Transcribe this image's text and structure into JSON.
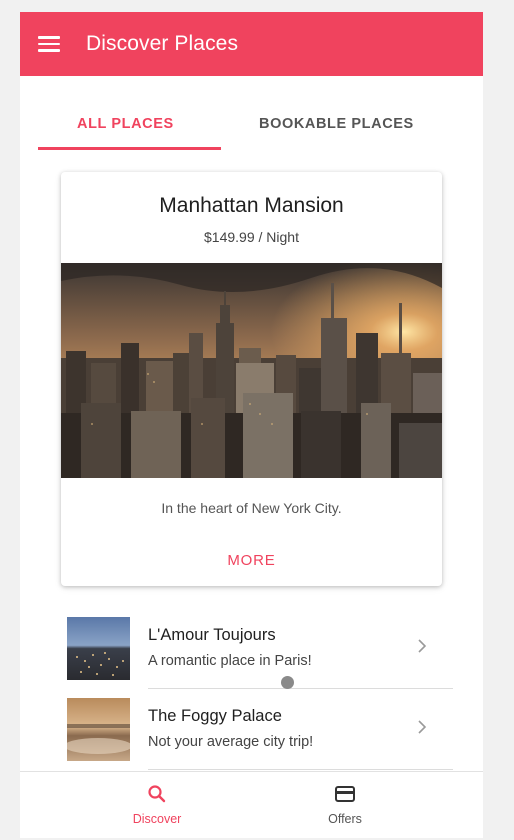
{
  "header": {
    "title": "Discover Places",
    "menu_icon": "menu-icon"
  },
  "tabs": [
    {
      "label": "ALL PLACES",
      "active": true
    },
    {
      "label": "BOOKABLE PLACES",
      "active": false
    }
  ],
  "featured": {
    "title": "Manhattan Mansion",
    "price": "$149.99 / Night",
    "description": "In the heart of New York City.",
    "more_label": "MORE"
  },
  "places": [
    {
      "title": "L'Amour Toujours",
      "subtitle": "A romantic place in Paris!"
    },
    {
      "title": "The Foggy Palace",
      "subtitle": "Not your average city trip!"
    }
  ],
  "bottom_nav": [
    {
      "label": "Discover",
      "icon": "search-icon",
      "active": true
    },
    {
      "label": "Offers",
      "icon": "card-icon",
      "active": false
    }
  ],
  "colors": {
    "accent": "#f0435e",
    "text": "#1f1f1f",
    "muted": "#555555"
  }
}
